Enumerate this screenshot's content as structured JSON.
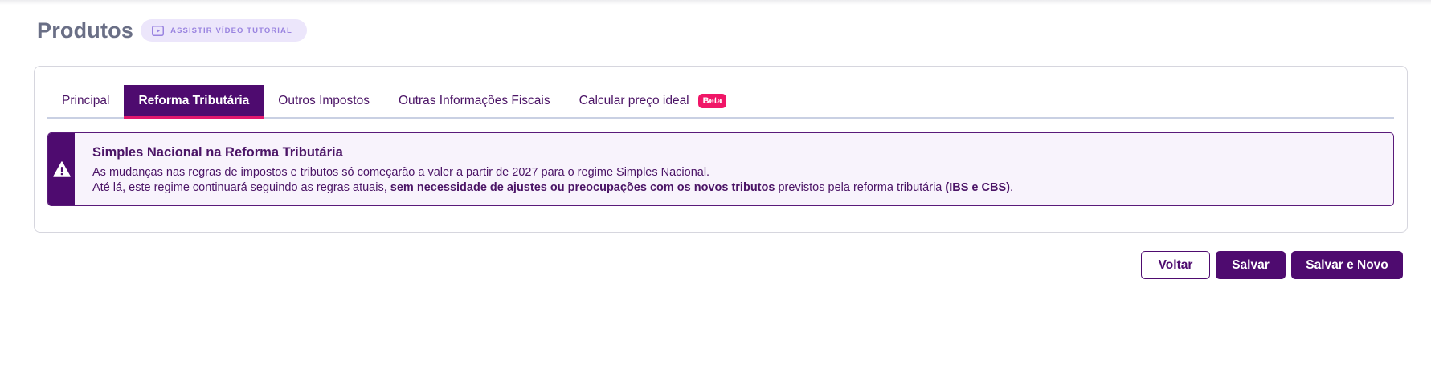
{
  "header": {
    "title": "Produtos",
    "tutorial_label": "ASSISTIR VÍDEO TUTORIAL"
  },
  "tabs": [
    {
      "label": "Principal",
      "active": false
    },
    {
      "label": "Reforma Tributária",
      "active": true
    },
    {
      "label": "Outros Impostos",
      "active": false
    },
    {
      "label": "Outras Informações Fiscais",
      "active": false
    },
    {
      "label": "Calcular preço ideal",
      "active": false,
      "badge": "Beta"
    }
  ],
  "alert": {
    "icon": "warning-icon",
    "title": "Simples Nacional na Reforma Tributária",
    "line1": "As mudanças nas regras de impostos e tributos só começarão a valer a partir de 2027 para o regime Simples Nacional.",
    "line2_pre": "Até lá, este regime continuará seguindo as regras atuais, ",
    "line2_bold": "sem necessidade de ajustes ou preocupações com os novos tributos",
    "line2_mid": " previstos pela reforma tributária ",
    "line2_bold2": "(IBS e CBS)",
    "line2_end": "."
  },
  "actions": {
    "back_label": "Voltar",
    "save_label": "Salvar",
    "save_new_label": "Salvar e Novo"
  },
  "colors": {
    "primary": "#4e0b6f",
    "accent": "#e2186e",
    "badge": "#f01667",
    "alert_bg": "#f8f3fc",
    "tutorial_bg": "#ece6fb"
  }
}
